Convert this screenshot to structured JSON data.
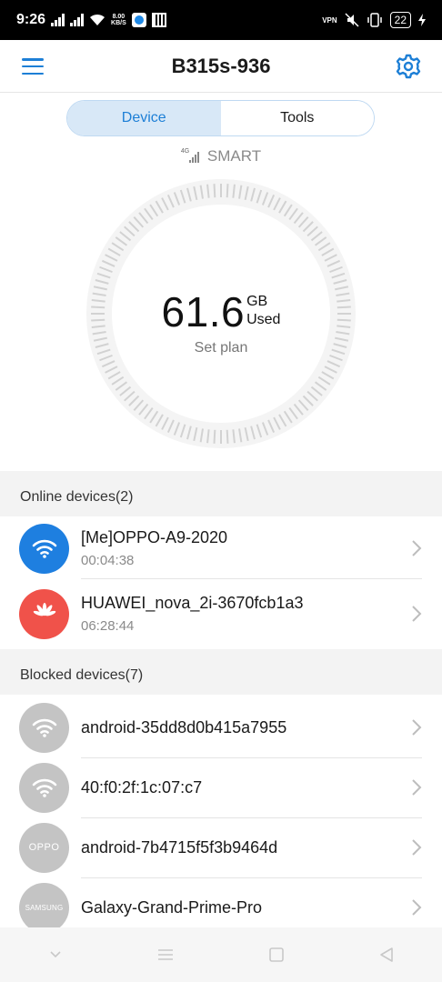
{
  "status_bar": {
    "time": "9:26",
    "speed_top": "8.00",
    "speed_bottom": "KB/S",
    "vpn": "VPN",
    "battery": "22"
  },
  "header": {
    "title": "B315s-936",
    "menu_icon": "hamburger-menu-icon",
    "settings_icon": "gear-icon"
  },
  "tabs": [
    {
      "label": "Device",
      "active": true
    },
    {
      "label": "Tools",
      "active": false
    }
  ],
  "network": {
    "generation": "4G",
    "operator": "SMART"
  },
  "usage": {
    "value": "61.6",
    "unit": "GB",
    "unit_label": "Used",
    "plan_link": "Set plan"
  },
  "online": {
    "header": "Online devices(2)",
    "devices": [
      {
        "name": "[Me]OPPO-A9-2020",
        "time": "00:04:38",
        "icon": "wifi-icon",
        "color": "#1e7fe0"
      },
      {
        "name": "HUAWEI_nova_2i-3670fcb1a3",
        "time": "06:28:44",
        "icon": "huawei-logo-icon",
        "color": "#f0524a"
      }
    ]
  },
  "blocked": {
    "header": "Blocked devices(7)",
    "devices": [
      {
        "name": "android-35dd8d0b415a7955",
        "icon": "wifi-icon"
      },
      {
        "name": "40:f0:2f:1c:07:c7",
        "icon": "wifi-icon"
      },
      {
        "name": "android-7b4715f5f3b9464d",
        "icon": "oppo-logo-icon",
        "brand": "OPPO"
      },
      {
        "name": "Galaxy-Grand-Prime-Pro",
        "icon": "samsung-logo-icon",
        "brand": "SAMSUNG"
      }
    ],
    "avatar_color": "#c4c4c4"
  },
  "colors": {
    "accent": "#1d7fd6",
    "online_wifi": "#1e7fe0",
    "huawei": "#f0524a",
    "blocked": "#c4c4c4"
  }
}
